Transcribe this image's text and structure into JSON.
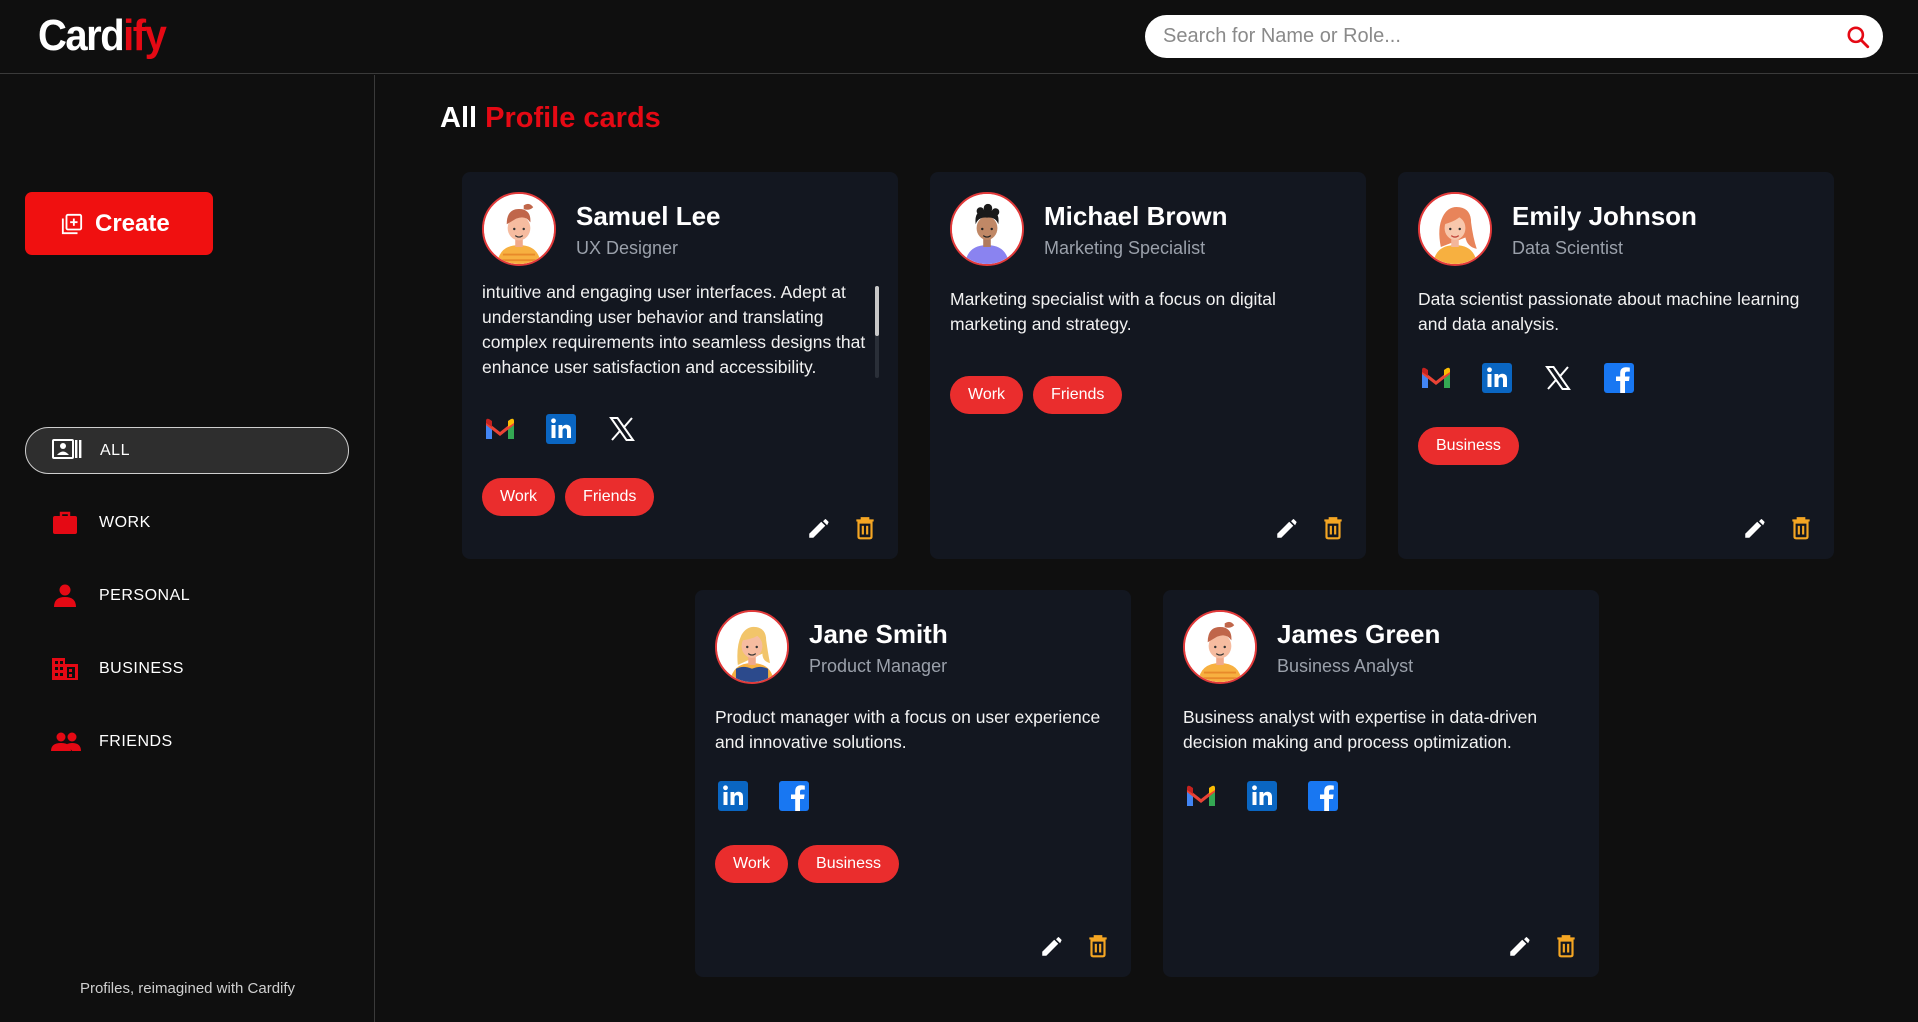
{
  "header": {
    "logo_white": "Card",
    "logo_red": "ify",
    "search_placeholder": "Search for Name or Role..."
  },
  "sidebar": {
    "create_label": "Create",
    "items": [
      {
        "label": "ALL",
        "icon": "contacts-icon",
        "active": true
      },
      {
        "label": "WORK",
        "icon": "briefcase-icon",
        "active": false
      },
      {
        "label": "PERSONAL",
        "icon": "person-icon",
        "active": false
      },
      {
        "label": "BUSINESS",
        "icon": "building-icon",
        "active": false
      },
      {
        "label": "FRIENDS",
        "icon": "people-icon",
        "active": false
      }
    ],
    "footer": "Profiles, reimagined with Cardify"
  },
  "main": {
    "title_prefix": "All",
    "title_highlight": "Profile cards",
    "cards": [
      {
        "name": "Samuel Lee",
        "role": "UX Designer",
        "description": "Creative UX designer with a passion for crafting intuitive and engaging user interfaces. Adept at understanding user behavior and translating complex requirements into seamless designs that enhance user satisfaction and accessibility. Proficient in leveraging design principles and",
        "socials": [
          "gmail-icon",
          "linkedin-icon",
          "x-icon"
        ],
        "tags": [
          "Work",
          "Friends"
        ]
      },
      {
        "name": "Michael Brown",
        "role": "Marketing Specialist",
        "description": "Marketing specialist with a focus on digital marketing and strategy.",
        "socials": [],
        "tags": [
          "Work",
          "Friends"
        ]
      },
      {
        "name": "Emily Johnson",
        "role": "Data Scientist",
        "description": "Data scientist passionate about machine learning and data analysis.",
        "socials": [
          "gmail-icon",
          "linkedin-icon",
          "x-icon",
          "facebook-icon"
        ],
        "tags": [
          "Business"
        ]
      },
      {
        "name": "Jane Smith",
        "role": "Product Manager",
        "description": "Product manager with a focus on user experience and innovative solutions.",
        "socials": [
          "linkedin-icon",
          "facebook-icon"
        ],
        "tags": [
          "Work",
          "Business"
        ]
      },
      {
        "name": "James Green",
        "role": "Business Analyst",
        "description": "Business analyst with expertise in data-driven decision making and process optimization.",
        "socials": [
          "gmail-icon",
          "linkedin-icon",
          "facebook-icon"
        ],
        "tags": []
      }
    ]
  },
  "colors": {
    "accent": "#e50914",
    "tag": "#ea2d2d",
    "card_bg": "#131720",
    "edit_icon": "#ffffff",
    "delete_icon": "#f5a623"
  }
}
